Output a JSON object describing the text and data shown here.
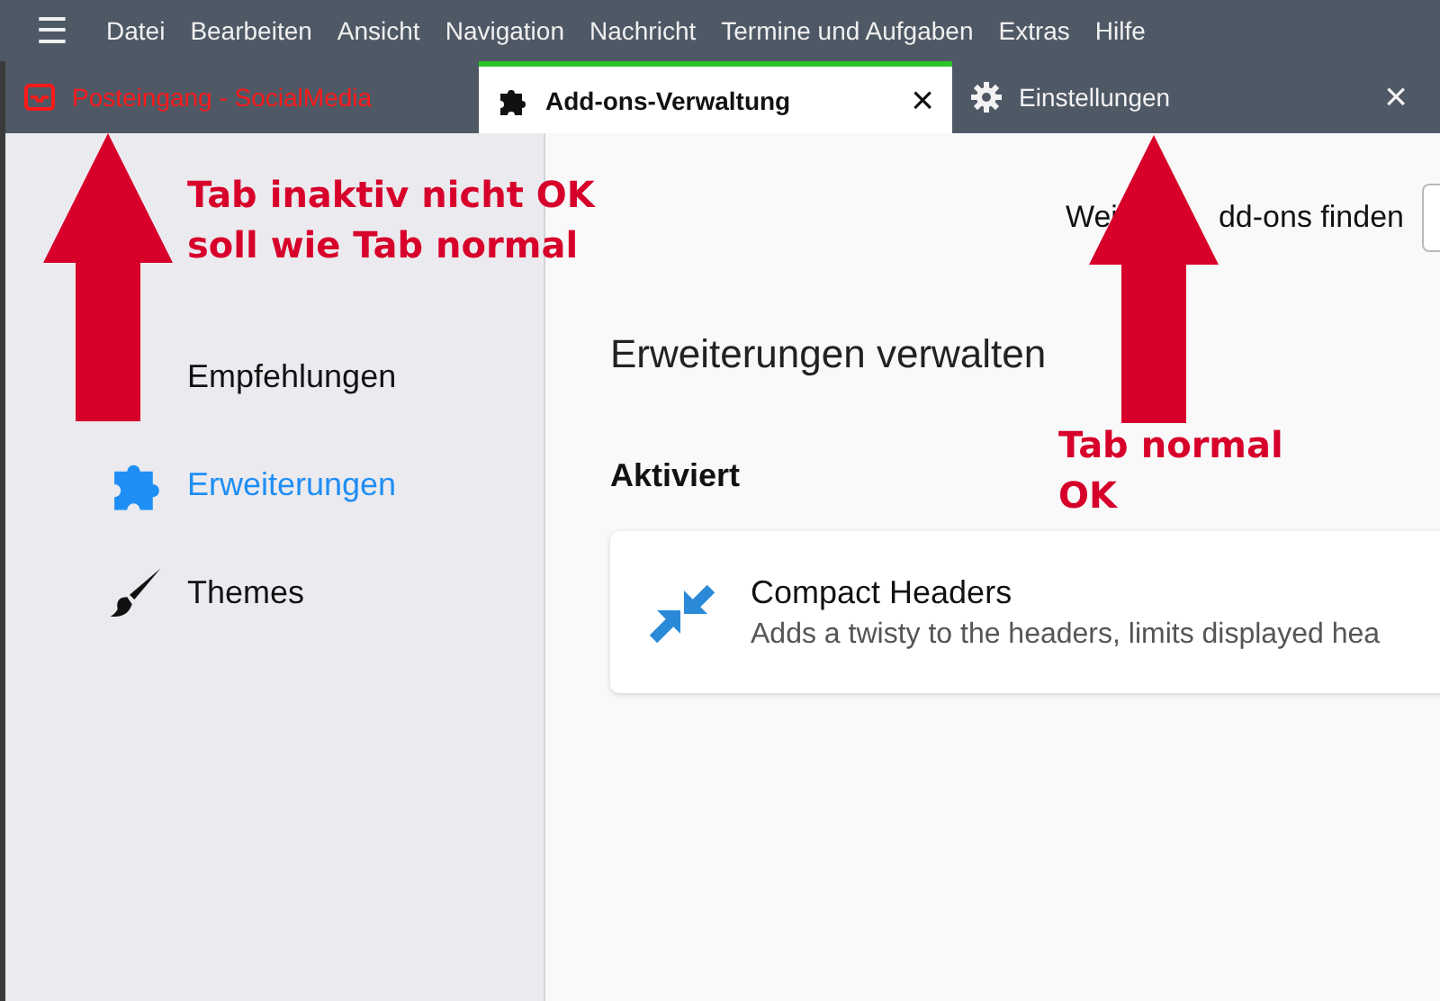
{
  "menubar": {
    "menu_icon": "☰",
    "items": [
      {
        "label": "Datei"
      },
      {
        "label": "Bearbeiten"
      },
      {
        "label": "Ansicht"
      },
      {
        "label": "Navigation"
      },
      {
        "label": "Nachricht"
      },
      {
        "label": "Termine und Aufgaben"
      },
      {
        "label": "Extras"
      },
      {
        "label": "Hilfe"
      }
    ]
  },
  "tabs": [
    {
      "label": "Posteingang - SocialMedia",
      "kind": "mail",
      "selected": false,
      "alert": true
    },
    {
      "label": "Add-ons-Verwaltung",
      "kind": "addons",
      "selected": true,
      "alert": false,
      "close": "×"
    },
    {
      "label": "Einstellungen",
      "kind": "settings",
      "selected": false,
      "alert": false,
      "close": "×"
    }
  ],
  "sidebar": {
    "items": [
      {
        "label": "Empfehlungen",
        "kind": "recommend",
        "selected": false
      },
      {
        "label": "Erweiterungen",
        "kind": "extensions",
        "selected": true
      },
      {
        "label": "Themes",
        "kind": "themes",
        "selected": false
      }
    ]
  },
  "main": {
    "find_label_parts": [
      "Wei",
      "dd-ons finden"
    ],
    "heading": "Erweiterungen verwalten",
    "section": "Aktiviert",
    "addons": [
      {
        "name": "Compact Headers",
        "description": "Adds a twisty to the headers, limits displayed hea"
      }
    ]
  },
  "annotations": [
    {
      "lines": [
        "Tab inaktiv nicht OK",
        "soll wie Tab normal"
      ]
    },
    {
      "lines": [
        "Tab normal",
        "OK"
      ]
    }
  ]
}
